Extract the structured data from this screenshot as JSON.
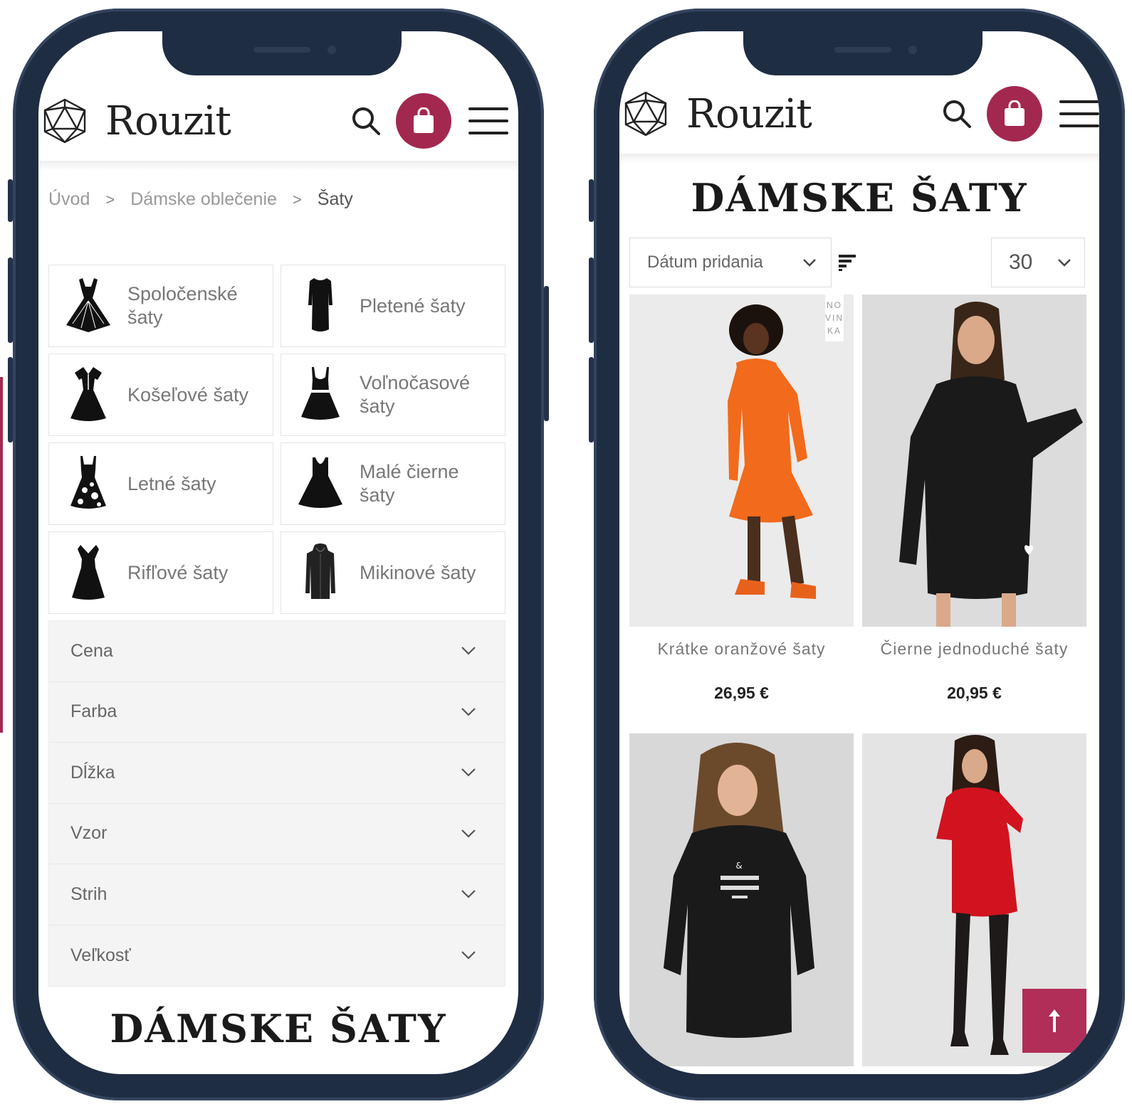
{
  "brand": {
    "name": "Rouzit",
    "accent_color": "#a3284f"
  },
  "header": {
    "search_icon": "search-icon",
    "cart_icon": "shopping-bag-icon",
    "menu_icon": "hamburger-menu-icon"
  },
  "left_screen": {
    "breadcrumb": [
      {
        "label": "Úvod"
      },
      {
        "label": "Dámske oblečenie"
      },
      {
        "label": "Šaty"
      }
    ],
    "categories": [
      {
        "label": "Spoločenské šaty",
        "icon": "evening-dress-icon"
      },
      {
        "label": "Pletené šaty",
        "icon": "knit-dress-icon"
      },
      {
        "label": "Košeľové šaty",
        "icon": "shirt-dress-icon"
      },
      {
        "label": "Voľnočasové šaty",
        "icon": "casual-dress-icon"
      },
      {
        "label": "Letné šaty",
        "icon": "summer-dress-icon"
      },
      {
        "label": "Malé čierne šaty",
        "icon": "little-black-dress-icon"
      },
      {
        "label": "Rifľové šaty",
        "icon": "denim-dress-icon"
      },
      {
        "label": "Mikinové šaty",
        "icon": "hoodie-dress-icon"
      }
    ],
    "filters": [
      {
        "label": "Cena"
      },
      {
        "label": "Farba"
      },
      {
        "label": "Dĺžka"
      },
      {
        "label": "Vzor"
      },
      {
        "label": "Strih"
      },
      {
        "label": "Veľkosť"
      }
    ],
    "page_title": "DÁMSKE ŠATY"
  },
  "right_screen": {
    "page_title": "DÁMSKE ŠATY",
    "sort": {
      "selected": "Dátum pridania"
    },
    "per_page": {
      "selected": "30"
    },
    "products": [
      {
        "name": "Krátke oranžové šaty",
        "price": "26,95 €",
        "badge": "NOVINKA",
        "dress_color": "#f26a1b"
      },
      {
        "name": "Čierne jednoduché šaty",
        "price": "20,95 €",
        "badge": "",
        "dress_color": "#1a1a1a"
      },
      {
        "name": "",
        "price": "",
        "badge": "",
        "dress_color": "#1a1a1a"
      },
      {
        "name": "",
        "price": "",
        "badge": "",
        "dress_color": "#d0131f"
      }
    ],
    "back_to_top_icon": "arrow-up-icon"
  }
}
